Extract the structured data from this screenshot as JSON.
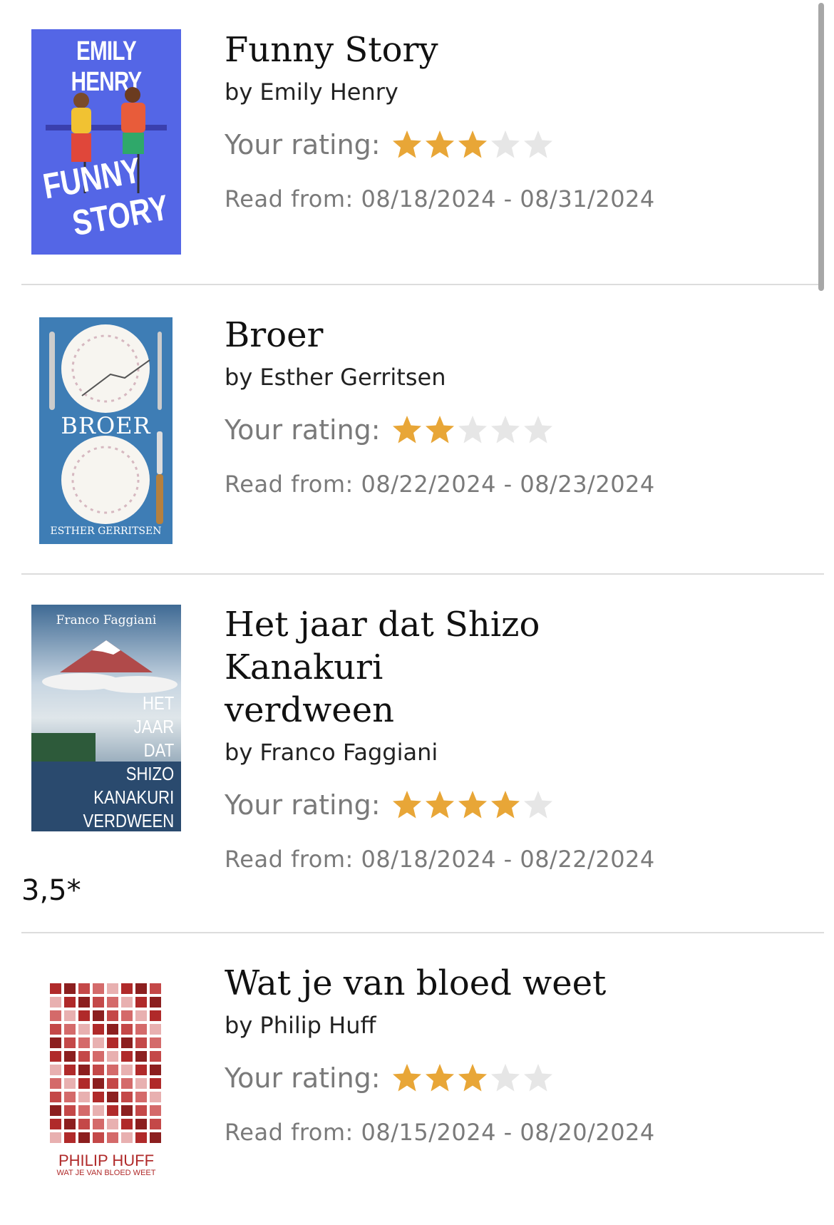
{
  "colors": {
    "star_filled": "#e8a637",
    "star_empty": "#e6e6e6"
  },
  "books": [
    {
      "title": "Funny Story",
      "author": "by Emily Henry",
      "rating_label": "Your rating:",
      "stars": 3,
      "dates": "Read from: 08/18/2024 - 08/31/2024",
      "cover": {
        "top_text": "EMILY HENRY",
        "title_line1": "FUNNY",
        "title_line2": "STORY",
        "bg": "#5466e6"
      }
    },
    {
      "title": "Broer",
      "author": "by Esther Gerritsen",
      "rating_label": "Your rating:",
      "stars": 2,
      "dates": "Read from: 08/22/2024 - 08/23/2024",
      "cover": {
        "title": "BROER",
        "author": "ESTHER GERRITSEN",
        "bg": "#3e7db5"
      }
    },
    {
      "title": "Het jaar dat Shizo Kanakuri verdween",
      "author": "by Franco Faggiani",
      "rating_label": "Your rating:",
      "stars": 4,
      "dates": "Read from: 08/18/2024 - 08/22/2024",
      "note": "3,5*",
      "cover": {
        "author": "Franco Faggiani",
        "lines": [
          "HET",
          "JAAR",
          "DAT",
          "SHIZO",
          "KANAKURI",
          "VERDWEEN"
        ],
        "bg": "#2b4f7c"
      }
    },
    {
      "title": "Wat je van bloed weet",
      "author": "by Philip Huff",
      "rating_label": "Your rating:",
      "stars": 3,
      "dates": "Read from: 08/15/2024 - 08/20/2024",
      "cover": {
        "author": "PHILIP HUFF",
        "subtitle": "WAT JE VAN BLOED WEET",
        "accent": "#b02a2a"
      }
    }
  ]
}
